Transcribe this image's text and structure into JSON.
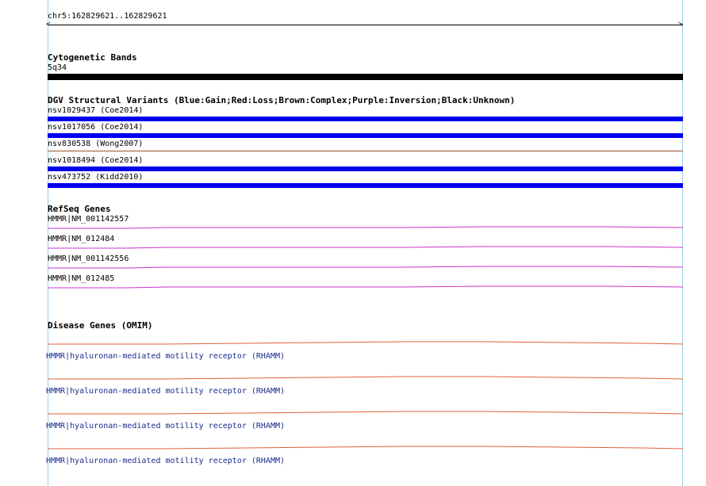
{
  "locus": "chr5:162829621..162829621",
  "tracks": {
    "cytogenetic": {
      "title": "Cytogenetic Bands",
      "items": [
        {
          "label": "5q34",
          "color": "#000000"
        }
      ]
    },
    "dgv": {
      "title": "DGV Structural Variants (Blue:Gain;Red:Loss;Brown:Complex;Purple:Inversion;Black:Unknown)",
      "items": [
        {
          "label": "nsv1029437 (Coe2014)",
          "color": "#0000ee",
          "kind": "gain"
        },
        {
          "label": "nsv1017056 (Coe2014)",
          "color": "#0000ee",
          "kind": "gain"
        },
        {
          "label": "nsv830538 (Wong2007)",
          "color": "#a0522d",
          "kind": "complex"
        },
        {
          "label": "nsv1018494 (Coe2014)",
          "color": "#0000ee",
          "kind": "gain"
        },
        {
          "label": "nsv473752 (Kidd2010)",
          "color": "#0000ee",
          "kind": "gain"
        }
      ]
    },
    "refseq": {
      "title": "RefSeq Genes",
      "color": "#cc33cc",
      "items": [
        {
          "label": "HMMR|NM_001142557"
        },
        {
          "label": "HMMR|NM_012484"
        },
        {
          "label": "HMMR|NM_001142556"
        },
        {
          "label": "HMMR|NM_012485"
        }
      ]
    },
    "omim": {
      "title": "Disease Genes (OMIM)",
      "color": "#e0603a",
      "items": [
        {
          "label": "HMMR|hyaluronan-mediated motility receptor (RHAMM)"
        },
        {
          "label": "HMMR|hyaluronan-mediated motility receptor (RHAMM)"
        },
        {
          "label": "HMMR|hyaluronan-mediated motility receptor (RHAMM)"
        },
        {
          "label": "HMMR|hyaluronan-mediated motility receptor (RHAMM)"
        }
      ]
    }
  }
}
